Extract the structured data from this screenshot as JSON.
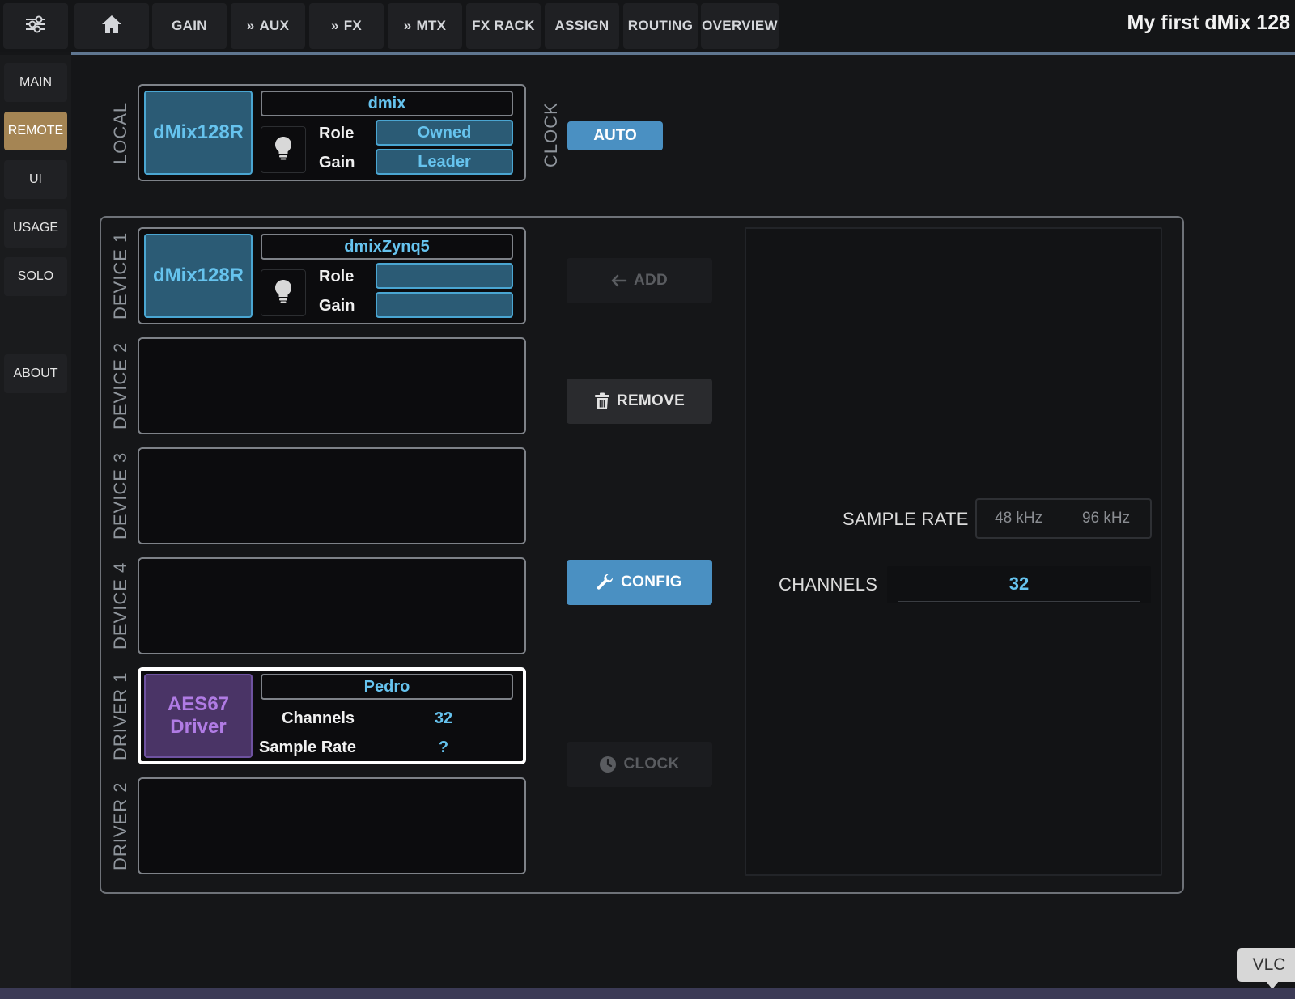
{
  "header": {
    "menu_icon": "sliders-icon",
    "home_icon": "home-icon",
    "tabs": [
      {
        "label": "GAIN",
        "chevron": false
      },
      {
        "label": "AUX",
        "chevron": true
      },
      {
        "label": "FX",
        "chevron": true
      },
      {
        "label": "MTX",
        "chevron": true
      },
      {
        "label": "FX RACK",
        "chevron": false
      },
      {
        "label": "ASSIGN",
        "chevron": false
      },
      {
        "label": "ROUTING",
        "chevron": false
      },
      {
        "label": "OVERVIEW",
        "chevron": false
      }
    ],
    "title": "My first dMix 128"
  },
  "sidebar": {
    "items": [
      {
        "label": "MAIN",
        "active": false
      },
      {
        "label": "REMOTE",
        "active": true
      },
      {
        "label": "UI",
        "active": false
      },
      {
        "label": "USAGE",
        "active": false
      },
      {
        "label": "SOLO",
        "active": false
      },
      {
        "label": "ABOUT",
        "active": false
      }
    ]
  },
  "local": {
    "section_label": "LOCAL",
    "device_type": "dMix128R",
    "name": "dmix",
    "role_label": "Role",
    "role_value": "Owned",
    "gain_label": "Gain",
    "gain_value": "Leader",
    "clock_label": "CLOCK",
    "clock_mode": "AUTO"
  },
  "slots": {
    "device1": {
      "label": "DEVICE 1",
      "device_type": "dMix128R",
      "name": "dmixZynq5",
      "role_label": "Role",
      "role_value": "",
      "gain_label": "Gain",
      "gain_value": ""
    },
    "device2": {
      "label": "DEVICE 2"
    },
    "device3": {
      "label": "DEVICE 3"
    },
    "device4": {
      "label": "DEVICE 4"
    },
    "driver1": {
      "label": "DRIVER 1",
      "device_type": "AES67\nDriver",
      "name": "Pedro",
      "channels_label": "Channels",
      "channels_value": "32",
      "sample_rate_label": "Sample Rate",
      "sample_rate_value": "?"
    },
    "driver2": {
      "label": "DRIVER 2"
    }
  },
  "actions": {
    "add": "ADD",
    "remove": "REMOVE",
    "config": "CONFIG",
    "clock": "CLOCK"
  },
  "config": {
    "sample_rate_label": "SAMPLE RATE",
    "sample_rate_options": [
      "48 kHz",
      "96 kHz"
    ],
    "channels_label": "CHANNELS",
    "channels_value": "32"
  },
  "overlay": {
    "vlc_label": "VLC"
  },
  "colors": {
    "accent_blue": "#66c3ee",
    "active_tab": "#a58554",
    "driver_purple": "#b07be4",
    "primary_button": "#4a90c2"
  }
}
